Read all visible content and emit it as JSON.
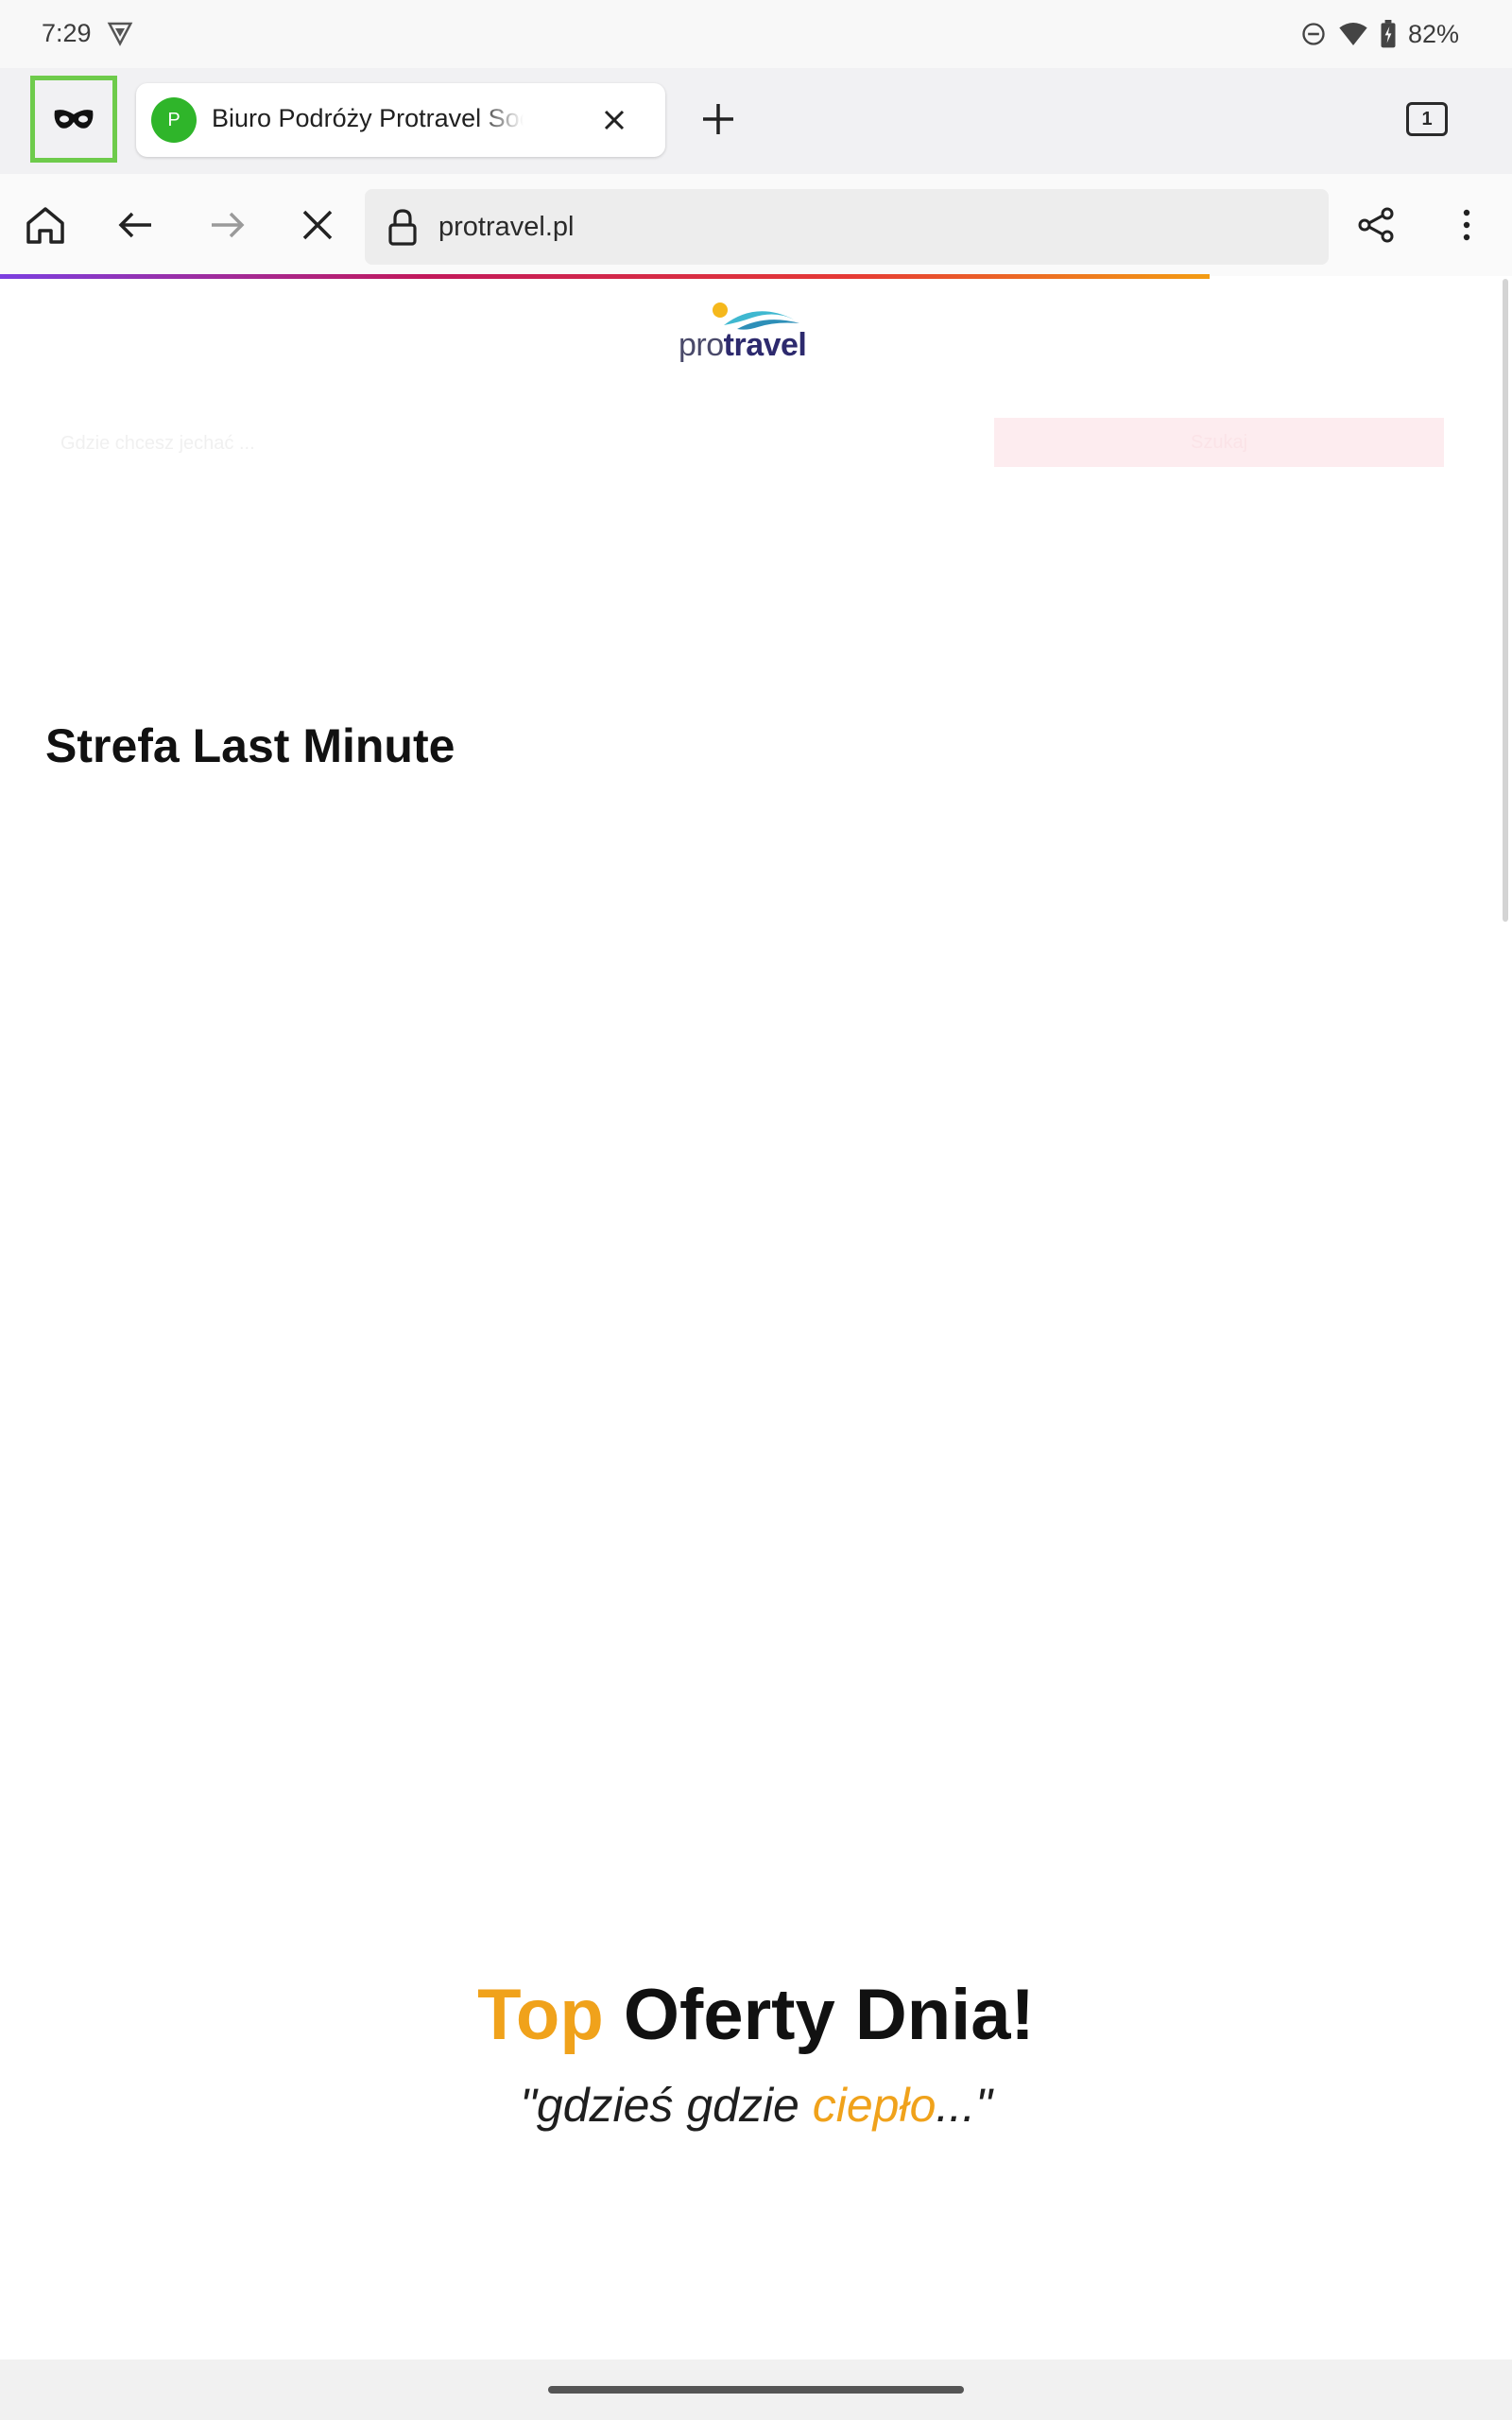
{
  "status_bar": {
    "time": "7:29",
    "battery": "82%",
    "icons": [
      "vpn-shield-icon",
      "do-not-disturb-icon",
      "wifi-icon",
      "battery-charging-icon"
    ]
  },
  "tabs": {
    "active": {
      "favicon_letter": "P",
      "title": "Biuro Podróży Protravel Sochaczew",
      "favicon_color": "#2fb52a"
    },
    "count": "1",
    "incognito_highlight_color": "#6ecb4b"
  },
  "toolbar": {
    "url": "protravel.pl",
    "icons": [
      "home-icon",
      "back-icon",
      "forward-icon",
      "stop-icon",
      "share-icon",
      "more-icon"
    ]
  },
  "page": {
    "logo": {
      "part1": "pro",
      "part2": "travel"
    },
    "search_placeholder_ghost": "Gdzie chcesz jechać ...",
    "search_button_ghost": "Szukaj",
    "section_heading": "Strefa Last Minute",
    "top_offers": {
      "accent": "Top",
      "rest": " Oferty Dnia!",
      "subtitle_start": "\"gdzieś gdzie ",
      "subtitle_accent": "ciepło",
      "subtitle_end": "...\"",
      "accent_color": "#f0a21b"
    }
  }
}
